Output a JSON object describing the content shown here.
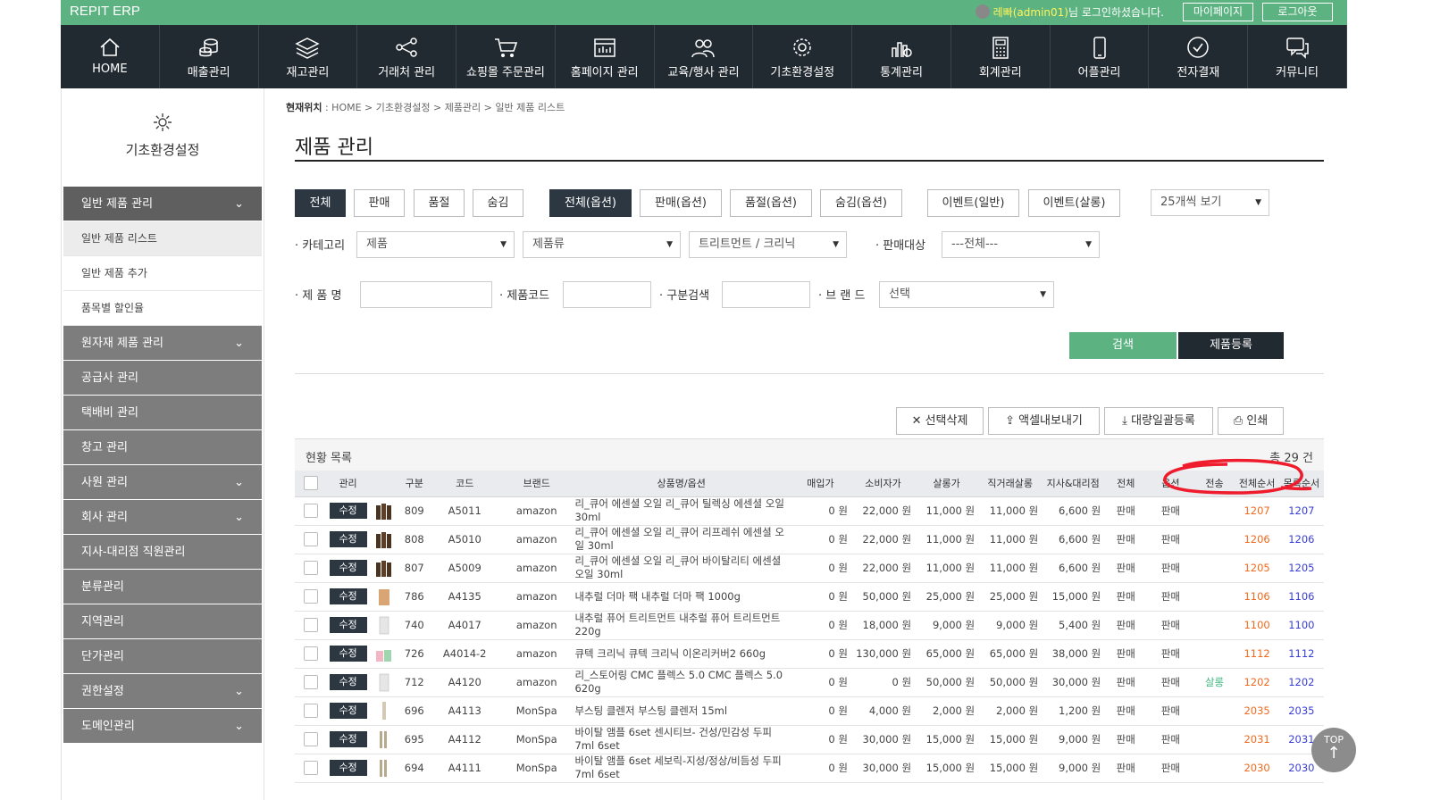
{
  "app": {
    "brand": "REPIT ERP"
  },
  "top": {
    "user_name": "레빠(admin01)",
    "login_suffix": "님 로그인하셨습니다.",
    "mypage": "마이페이지",
    "logout": "로그아웃"
  },
  "nav": [
    {
      "label": "HOME",
      "icon": "home-icon"
    },
    {
      "label": "매출관리",
      "icon": "coins-icon"
    },
    {
      "label": "재고관리",
      "icon": "layers-icon"
    },
    {
      "label": "거래처 관리",
      "icon": "network-icon"
    },
    {
      "label": "쇼핑몰 주문관리",
      "icon": "cart-icon"
    },
    {
      "label": "홈페이지 관리",
      "icon": "browser-icon"
    },
    {
      "label": "교육/행사 관리",
      "icon": "people-icon"
    },
    {
      "label": "기초환경설정",
      "icon": "gear-icon"
    },
    {
      "label": "통계관리",
      "icon": "chart-icon"
    },
    {
      "label": "회계관리",
      "icon": "calculator-icon"
    },
    {
      "label": "어플관리",
      "icon": "mobile-icon"
    },
    {
      "label": "전자결재",
      "icon": "check-circle-icon"
    },
    {
      "label": "커뮤니티",
      "icon": "chat-icon"
    }
  ],
  "sidebar": {
    "title": "기초환경설정",
    "menus": [
      {
        "label": "일반 제품 관리",
        "chev": true,
        "active": true
      },
      {
        "label": "원자재 제품 관리",
        "chev": true
      },
      {
        "label": "공급사 관리",
        "chev": false
      },
      {
        "label": "택배비 관리",
        "chev": false
      },
      {
        "label": "창고 관리",
        "chev": false
      },
      {
        "label": "사원 관리",
        "chev": true
      },
      {
        "label": "회사 관리",
        "chev": true
      },
      {
        "label": "지사-대리점 직원관리",
        "chev": false
      },
      {
        "label": "분류관리",
        "chev": false
      },
      {
        "label": "지역관리",
        "chev": false
      },
      {
        "label": "단가관리",
        "chev": false
      },
      {
        "label": "권한설정",
        "chev": true
      },
      {
        "label": "도메인관리",
        "chev": true
      }
    ],
    "subs": [
      "일반 제품 리스트",
      "일반 제품 추가",
      "품목별 할인율"
    ]
  },
  "breadcrumb": {
    "prefix": "현재위치",
    "path": " : HOME > 기초환경설정 > 제품관리 > 일반 제품 리스트"
  },
  "page_title": "제품 관리",
  "filters": {
    "tabs1": [
      "전체",
      "판매",
      "품절",
      "숨김"
    ],
    "tabs2": [
      "전체(옵션)",
      "판매(옵션)",
      "품절(옵션)",
      "숨김(옵션)"
    ],
    "tabs3": [
      "이벤트(일반)",
      "이벤트(살롱)"
    ],
    "per_page": "25개씩 보기",
    "category_label": "· 카테고리",
    "cat1": "제품",
    "cat2": "제품류",
    "cat3": "트리트먼트 / 크리닉",
    "target_label": "· 판매대상",
    "target": "---전체---",
    "name_label": "· 제 품 명",
    "code_label": "· 제품코드",
    "div_label": "· 구분검색",
    "brand_label": "· 브 랜 드",
    "brand": "선택",
    "search": "검색",
    "register": "제품등록"
  },
  "actions": [
    "선택삭제",
    "액셀내보내기",
    "대량일괄등록",
    "인쇄"
  ],
  "list": {
    "title": "현황 목록",
    "count": "총 29 건",
    "headers": [
      "",
      "관리",
      "",
      "구분",
      "코드",
      "브랜드",
      "상품명/옵션",
      "매입가",
      "소비자가",
      "살롱가",
      "직거래살롱",
      "지사&대리점",
      "전체",
      "옵션",
      "전송",
      "전체순서",
      "목록순서"
    ],
    "edit_label": "수정",
    "rows": [
      {
        "id": "809",
        "code": "A5011",
        "brand": "amazon",
        "name": "리_큐어 에센셜 오일 리_큐어 틸렉싱 에센셜 오일 30ml",
        "buy": "0 원",
        "cons": "22,000 원",
        "salon": "11,000 원",
        "direct": "11,000 원",
        "branch": "6,600 원",
        "all": "판매",
        "opt": "판매",
        "send": "",
        "o1": "1207",
        "o2": "1207",
        "thumb": "bottles"
      },
      {
        "id": "808",
        "code": "A5010",
        "brand": "amazon",
        "name": "리_큐어 에센셜 오일 리_큐어 리프레쉬 에센셜 오일 30ml",
        "buy": "0 원",
        "cons": "22,000 원",
        "salon": "11,000 원",
        "direct": "11,000 원",
        "branch": "6,600 원",
        "all": "판매",
        "opt": "판매",
        "send": "",
        "o1": "1206",
        "o2": "1206",
        "thumb": "bottles"
      },
      {
        "id": "807",
        "code": "A5009",
        "brand": "amazon",
        "name": "리_큐어 에센셜 오일 리_큐어 바이탈리티 에센셜 오일 30ml",
        "buy": "0 원",
        "cons": "22,000 원",
        "salon": "11,000 원",
        "direct": "11,000 원",
        "branch": "6,600 원",
        "all": "판매",
        "opt": "판매",
        "send": "",
        "o1": "1205",
        "o2": "1205",
        "thumb": "bottles"
      },
      {
        "id": "786",
        "code": "A4135",
        "brand": "amazon",
        "name": "내추럴 더마 팩 내추럴 더마 팩 1000g",
        "buy": "0 원",
        "cons": "50,000 원",
        "salon": "25,000 원",
        "direct": "25,000 원",
        "branch": "15,000 원",
        "all": "판매",
        "opt": "판매",
        "send": "",
        "o1": "1106",
        "o2": "1106",
        "thumb": "tan"
      },
      {
        "id": "740",
        "code": "A4017",
        "brand": "amazon",
        "name": "내추럴 퓨어 트리트먼트 내추럴 퓨어 트리트먼트 220g",
        "buy": "0 원",
        "cons": "18,000 원",
        "salon": "9,000 원",
        "direct": "9,000 원",
        "branch": "5,400 원",
        "all": "판매",
        "opt": "판매",
        "send": "",
        "o1": "1100",
        "o2": "1100",
        "thumb": "white"
      },
      {
        "id": "726",
        "code": "A4014-2",
        "brand": "amazon",
        "name": "큐텍 크리닉 큐텍 크리닉 이온리커버2 660g",
        "buy": "0 원",
        "cons": "130,000 원",
        "salon": "65,000 원",
        "direct": "65,000 원",
        "branch": "38,000 원",
        "all": "판매",
        "opt": "판매",
        "send": "",
        "o1": "1112",
        "o2": "1112",
        "thumb": "pink"
      },
      {
        "id": "712",
        "code": "A4120",
        "brand": "amazon",
        "name": "리_스토어링 CMC 플렉스 5.0 CMC 플렉스 5.0 620g",
        "buy": "0 원",
        "cons": "0 원",
        "salon": "50,000 원",
        "direct": "50,000 원",
        "branch": "30,000 원",
        "all": "판매",
        "opt": "판매",
        "send": "살롱",
        "o1": "1202",
        "o2": "1202",
        "thumb": "white"
      },
      {
        "id": "696",
        "code": "A4113",
        "brand": "MonSpa",
        "name": "부스팅 클렌저 부스팅 클렌저 15ml",
        "buy": "0 원",
        "cons": "4,000 원",
        "salon": "2,000 원",
        "direct": "2,000 원",
        "branch": "1,200 원",
        "all": "판매",
        "opt": "판매",
        "send": "",
        "o1": "2035",
        "o2": "2035",
        "thumb": "thin"
      },
      {
        "id": "695",
        "code": "A4112",
        "brand": "MonSpa",
        "name": "바이탈 앰플 6set 센시티브- 건성/민감성 두피 7ml 6set",
        "buy": "0 원",
        "cons": "30,000 원",
        "salon": "15,000 원",
        "direct": "15,000 원",
        "branch": "9,000 원",
        "all": "판매",
        "opt": "판매",
        "send": "",
        "o1": "2031",
        "o2": "2031",
        "thumb": "vials"
      },
      {
        "id": "694",
        "code": "A4111",
        "brand": "MonSpa",
        "name": "바이탈 앰플 6set 세보릭-지성/정상/비듬성 두피 7ml 6set",
        "buy": "0 원",
        "cons": "30,000 원",
        "salon": "15,000 원",
        "direct": "15,000 원",
        "branch": "9,000 원",
        "all": "판매",
        "opt": "판매",
        "send": "",
        "o1": "2030",
        "o2": "2030",
        "thumb": "vials"
      }
    ]
  },
  "top_button": "TOP"
}
